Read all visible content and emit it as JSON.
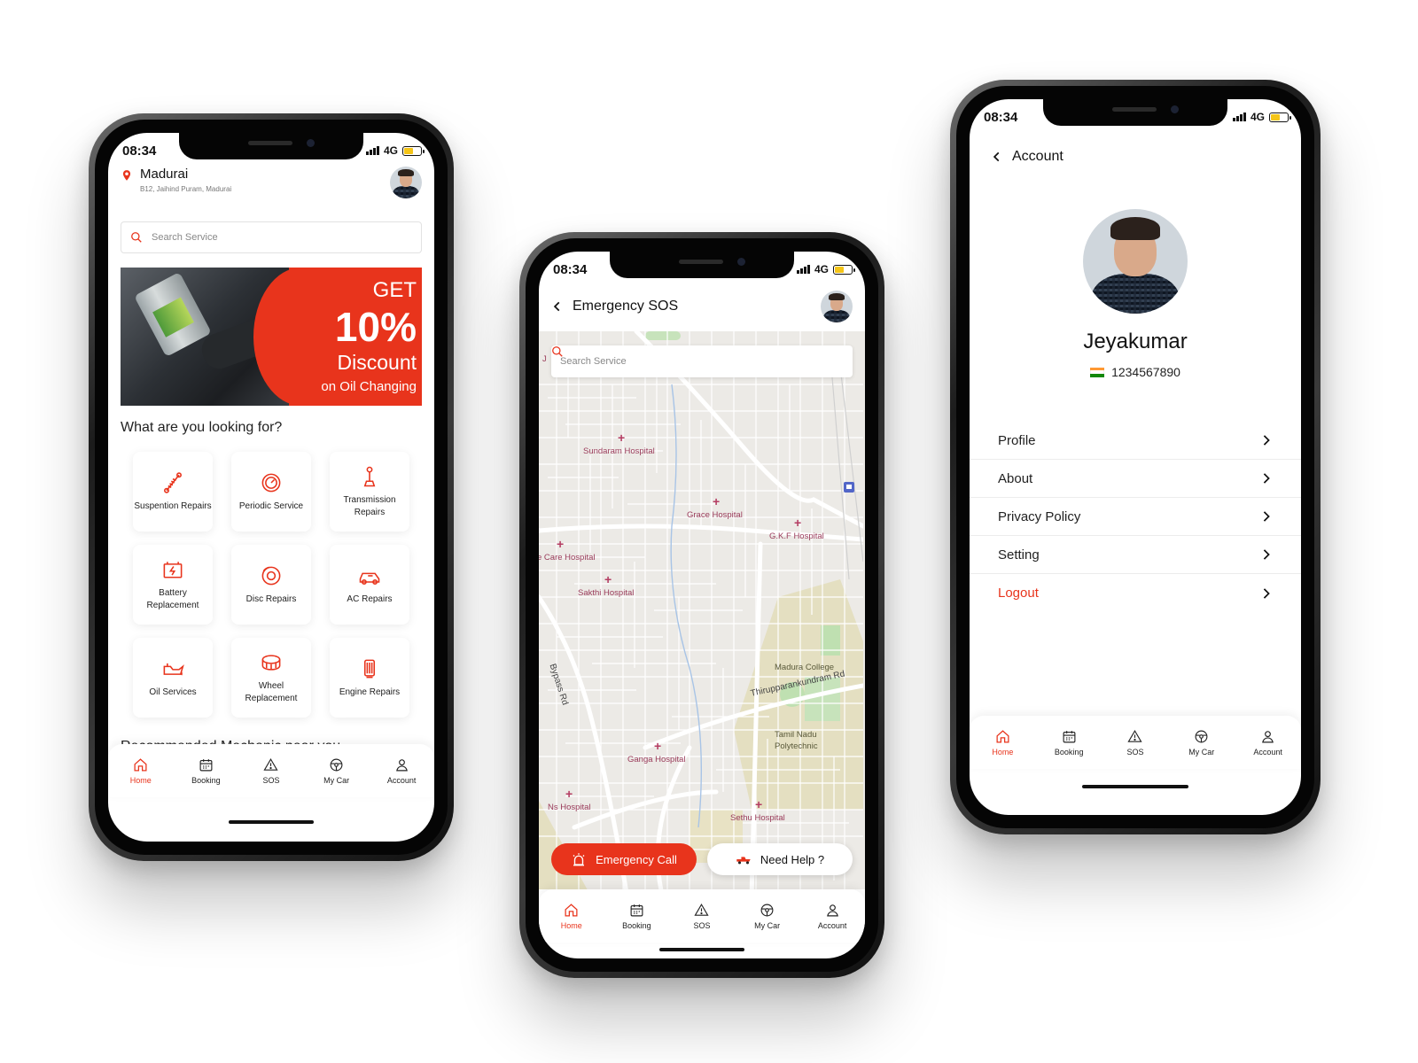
{
  "colors": {
    "accent": "#e8341c",
    "text": "#222222",
    "map_bg": "#eceae6",
    "hospital_label": "#9a3b5a"
  },
  "status": {
    "time": "08:34",
    "network": "4G"
  },
  "nav": {
    "items": [
      {
        "label": "Home",
        "icon": "home-icon",
        "active": true
      },
      {
        "label": "Booking",
        "icon": "calendar-icon"
      },
      {
        "label": "SOS",
        "icon": "warning-icon"
      },
      {
        "label": "My Car",
        "icon": "steering-wheel-icon"
      },
      {
        "label": "Account",
        "icon": "user-icon"
      }
    ]
  },
  "home": {
    "city": "Madurai",
    "address": "B12, Jaihind Puram, Madurai",
    "search_placeholder": "Search Service",
    "banner": {
      "line1": "GET",
      "line2": "10%",
      "line3": "Discount",
      "line4": "on Oil Changing"
    },
    "section_title": "What are you looking for?",
    "services": [
      {
        "label": "Suspention Repairs",
        "icon": "suspension-icon"
      },
      {
        "label": "Periodic Service",
        "icon": "speedometer-icon"
      },
      {
        "label": "Transmission Repairs",
        "icon": "gear-shift-icon"
      },
      {
        "label": "Battery Replacement",
        "icon": "battery-icon"
      },
      {
        "label": "Disc Repairs",
        "icon": "disc-brake-icon"
      },
      {
        "label": "AC Repairs",
        "icon": "car-ac-icon"
      },
      {
        "label": "Oil Services",
        "icon": "oil-can-icon"
      },
      {
        "label": "Wheel Replacement",
        "icon": "tyre-icon"
      },
      {
        "label": "Engine Repairs",
        "icon": "engine-icon"
      }
    ],
    "recommended_title": "Recommended Mechanic near you"
  },
  "sos": {
    "title": "Emergency SOS",
    "search_placeholder": "Search Service",
    "map_labels": {
      "sundaram": "Sundaram Hospital",
      "grace": "Grace Hospital",
      "gkf": "G.K.F Hospital",
      "care": "e Care Hospital",
      "sakthi": "Sakthi Hospital",
      "madura_college": "Madura College",
      "thirupparankundram": "Thirupparankundram Rd",
      "tamil_nadu": "Tamil Nadu",
      "polytechnic": "Polytechnic",
      "bypass": "Bypass Rd",
      "ganga": "Ganga Hospital",
      "ns": "Ns Hospital",
      "sethu": "Sethu Hospital",
      "edge_j": "J"
    },
    "emergency_button": "Emergency Call",
    "help_button": "Need Help ?"
  },
  "account": {
    "title": "Account",
    "name": "Jeyakumar",
    "phone": "1234567890",
    "menu": [
      {
        "label": "Profile"
      },
      {
        "label": "About"
      },
      {
        "label": "Privacy Policy"
      },
      {
        "label": "Setting"
      },
      {
        "label": "Logout"
      }
    ]
  }
}
